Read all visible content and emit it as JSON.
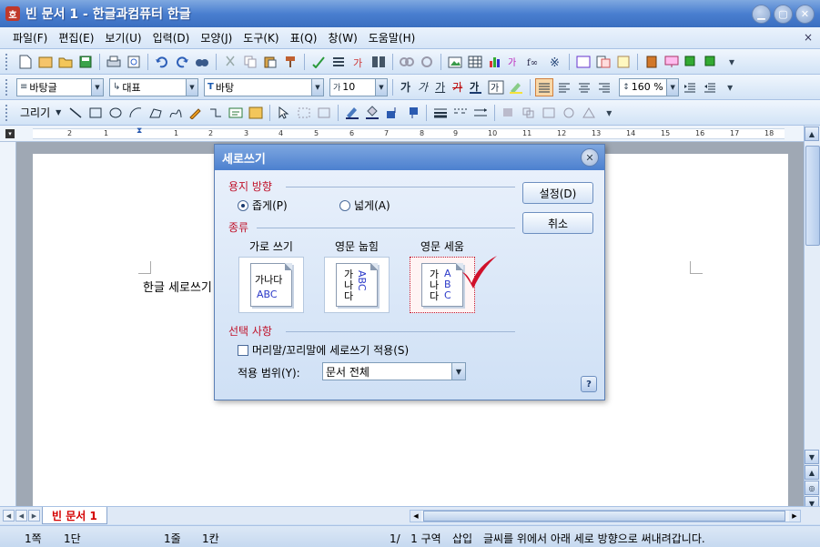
{
  "window": {
    "app_icon": "hwp-app-icon",
    "app_icon_glyph": "호",
    "title": "빈 문서 1 - 한글과컴퓨터 한글",
    "min_glyph": "▁",
    "max_glyph": "▢",
    "close_glyph": "✕"
  },
  "menu": {
    "items": [
      "파일(F)",
      "편집(E)",
      "보기(U)",
      "입력(D)",
      "모양(J)",
      "도구(K)",
      "표(Q)",
      "창(W)",
      "도움말(H)"
    ],
    "close_glyph": "×"
  },
  "format_toolbar": {
    "style": "바탕글",
    "language": "대표",
    "font": "바탕",
    "size": "10",
    "bold": "가",
    "italic": "가",
    "underline": "가",
    "strike": "가",
    "zoom": "160 %"
  },
  "draw_toolbar": {
    "draw_label": "그리기"
  },
  "ruler": {
    "numbers": [
      "2",
      "1",
      "1",
      "2",
      "3",
      "4",
      "5",
      "6",
      "7",
      "8",
      "9",
      "10",
      "11",
      "12",
      "13",
      "14",
      "15",
      "16",
      "17",
      "18",
      "19",
      "20"
    ]
  },
  "document": {
    "text": "한글 세로쓰기"
  },
  "tabs": {
    "active": "빈 문서 1"
  },
  "status": {
    "page": "1쪽",
    "column": "1단",
    "line": "1줄",
    "col": "1칸",
    "section": "1/   1 구역",
    "mode": "삽입",
    "message": "글씨를 위에서 아래 세로 방향으로 써내려갑니다."
  },
  "dialog": {
    "title": "세로쓰기",
    "close_glyph": "✕",
    "paper_direction_label": "용지 방향",
    "portrait": "좁게(P)",
    "landscape": "넓게(A)",
    "portrait_selected": true,
    "type_label": "종류",
    "types": [
      {
        "label": "가로 쓰기",
        "line1": "가나다",
        "line2": "ABC"
      },
      {
        "label": "영문 눕힘",
        "col1": "가나다",
        "col2": "ABC"
      },
      {
        "label": "영문 세움",
        "col1": "가나다",
        "col2": "ABC",
        "selected": true
      }
    ],
    "options_label": "선택 사항",
    "header_footer_check": "머리말/꼬리말에 세로쓰기 적용(S)",
    "apply_range_label": "적용 범위(Y):",
    "apply_range_value": "문서 전체",
    "ok_button": "설정(D)",
    "cancel_button": "취소",
    "help_glyph": "?"
  },
  "colors": {
    "accent_red": "#c0142c",
    "title_blue": "#4a7fd0",
    "checkmark_red": "#d0102a"
  }
}
